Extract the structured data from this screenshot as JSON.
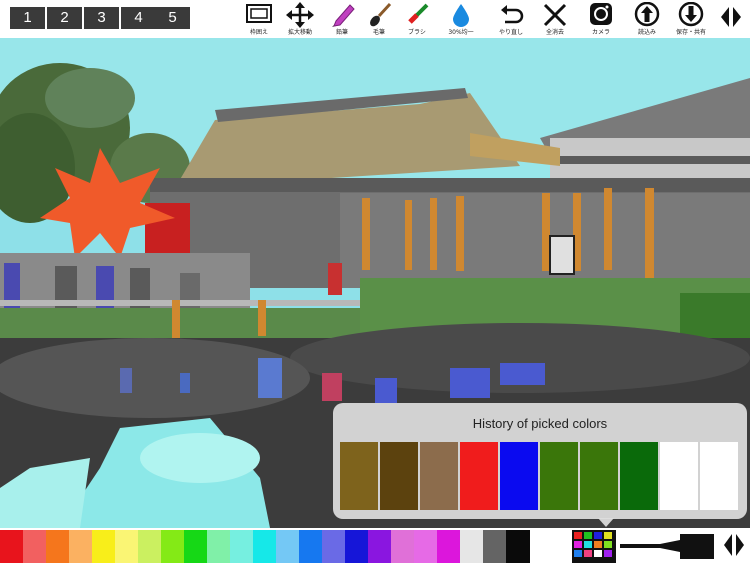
{
  "toolbar": {
    "pages": [
      "1",
      "2",
      "3",
      "4",
      "5"
    ],
    "tools": [
      {
        "name": "frame-tool",
        "icon": "frame-icon",
        "label": "枠囲え"
      },
      {
        "name": "pan-zoom-tool",
        "icon": "move-arrows-icon",
        "label": "拡大移動"
      },
      {
        "name": "pencil-tool",
        "icon": "pencil-icon",
        "label": "鉛筆"
      },
      {
        "name": "brush-tool",
        "icon": "paintbrush-icon",
        "label": "毛筆"
      },
      {
        "name": "marker-tool",
        "icon": "marker-icon",
        "label": "ブラシ"
      },
      {
        "name": "opacity-tool",
        "icon": "water-drop-icon",
        "label": "30%均一"
      },
      {
        "name": "undo-tool",
        "icon": "undo-icon",
        "label": "やり直し"
      },
      {
        "name": "clear-all-tool",
        "icon": "close-x-icon",
        "label": "全消去"
      },
      {
        "name": "camera-tool",
        "icon": "camera-icon",
        "label": "カメラ"
      },
      {
        "name": "load-tool",
        "icon": "up-arrow-circle-icon",
        "label": "読込み"
      },
      {
        "name": "save-share-tool",
        "icon": "down-arrow-circle-icon",
        "label": "保存・共有"
      }
    ]
  },
  "palette": {
    "colors": [
      "#e8141c",
      "#f26060",
      "#f5761c",
      "#fbb161",
      "#f8ee1a",
      "#faf574",
      "#cbf060",
      "#84ea16",
      "#16d816",
      "#80f0a8",
      "#76efe0",
      "#16e8e8",
      "#74c8f5",
      "#1678f0",
      "#6a6ae6",
      "#1616d8",
      "#8a16e0",
      "#e070d8",
      "#e66ae6",
      "#dc16dc",
      "#e6e6e6",
      "#646464",
      "#0a0a0a"
    ],
    "icons": [
      "color-grid-icon",
      "brush-size-icon",
      "expand-arrows-icon"
    ]
  },
  "history": {
    "title": "History of picked colors",
    "colors": [
      "#7e631c",
      "#5c420e",
      "#8c6c4c",
      "#f01c1c",
      "#0a0af0",
      "#3a760a",
      "#3a760a",
      "#0a6a0a",
      "#ffffff",
      "#ffffff"
    ]
  }
}
